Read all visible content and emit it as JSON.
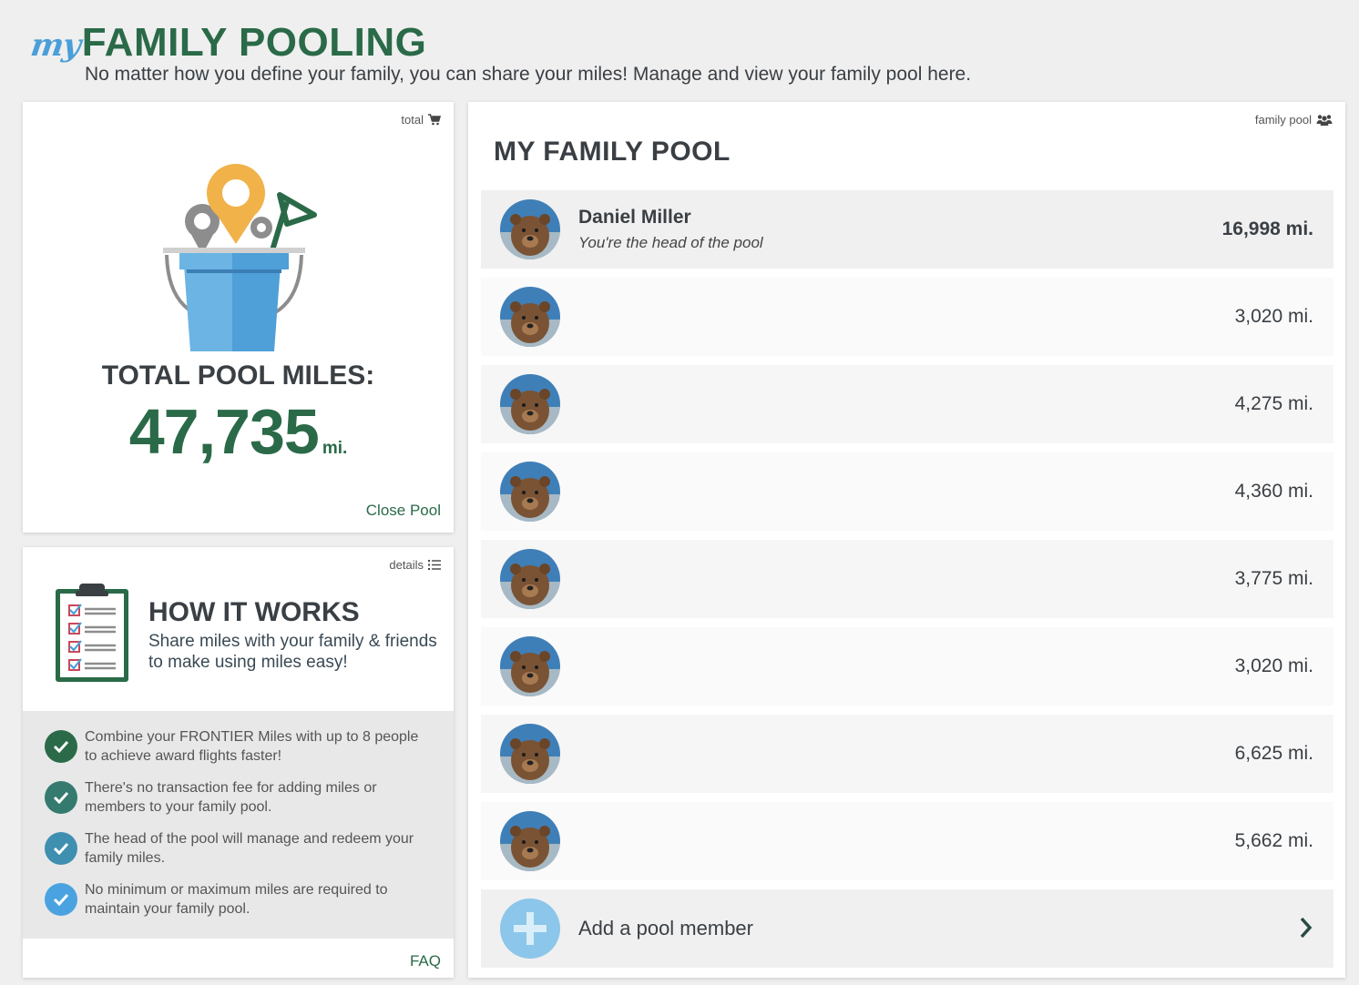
{
  "header": {
    "brand_my": "my",
    "brand_title": "FAMILY POOLING",
    "subtitle": "No matter how you define your family, you can share your miles! Manage and view your family pool here."
  },
  "total_card": {
    "tag": "total",
    "tag_icon": "cart-icon",
    "label": "TOTAL POOL MILES:",
    "value": "47,735",
    "unit": "mi.",
    "close_link": "Close Pool"
  },
  "works_card": {
    "tag": "details",
    "tag_icon": "list-icon",
    "title": "HOW IT WORKS",
    "subtitle": "Share miles with your family & friends to make using miles easy!",
    "items": [
      {
        "text": "Combine your FRONTIER Miles with up to 8 people to achieve award flights faster!",
        "color": "#2a6a48"
      },
      {
        "text": "There's no transaction fee for adding miles or members to your family pool.",
        "color": "#347a6e"
      },
      {
        "text": "The head of the pool will manage and redeem your family miles.",
        "color": "#3f8fb0"
      },
      {
        "text": "No minimum or maximum miles are required to maintain your family pool.",
        "color": "#4aa3e0"
      }
    ],
    "faq_link": "FAQ"
  },
  "pool_card": {
    "tag": "family pool",
    "tag_icon": "people-icon",
    "title": "MY FAMILY POOL",
    "members": [
      {
        "name": "Daniel Miller",
        "role": "You're the head of the pool",
        "miles": "16,998 mi."
      },
      {
        "name": "",
        "role": "",
        "miles": "3,020 mi."
      },
      {
        "name": "",
        "role": "",
        "miles": "4,275 mi."
      },
      {
        "name": "",
        "role": "",
        "miles": "4,360 mi."
      },
      {
        "name": "",
        "role": "",
        "miles": "3,775 mi."
      },
      {
        "name": "",
        "role": "",
        "miles": "3,020 mi."
      },
      {
        "name": "",
        "role": "",
        "miles": "6,625 mi."
      },
      {
        "name": "",
        "role": "",
        "miles": "5,662 mi."
      }
    ],
    "add_label": "Add a pool member"
  },
  "colors": {
    "brand_green": "#2a6a48",
    "brand_blue": "#4a9fd8",
    "background": "#efefef"
  }
}
